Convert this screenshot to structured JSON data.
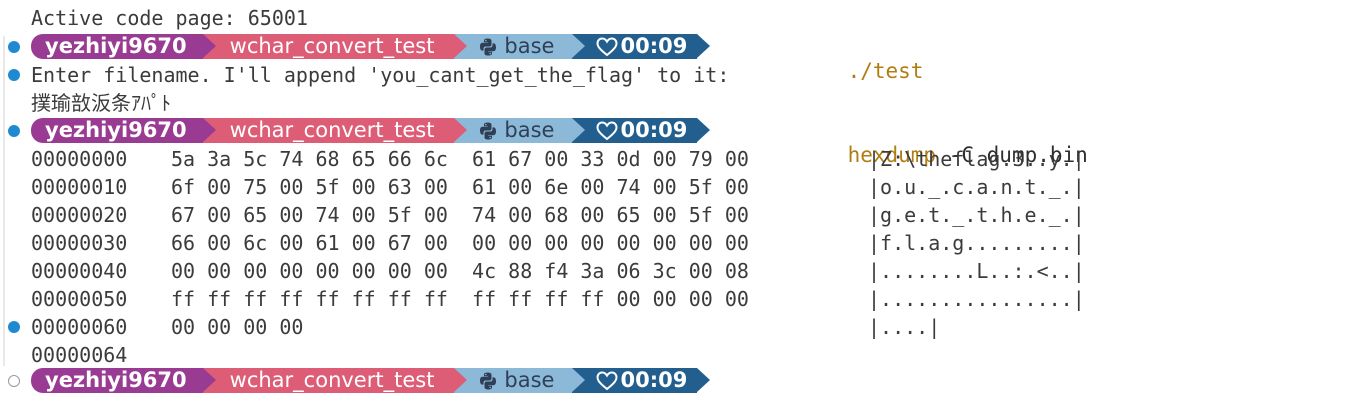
{
  "header_line": "Active code page: 65001",
  "prompt": {
    "user": "yezhiyi9670",
    "directory": "wchar_convert_test",
    "env_icon": "python-icon",
    "env": "base",
    "time_icon": "heart-icon",
    "time": "00:09"
  },
  "commands": {
    "first": "./test",
    "second_name": "hexdump",
    "second_args": " -C dump.bin"
  },
  "program_output": {
    "message": "Enter filename. I'll append 'you_cant_get_the_flag' to it:",
    "garbled": "撲瑜敨汳条ｱﾊﾟﾄ"
  },
  "hexdump_rows": [
    {
      "offset": "00000000",
      "bytes": "5a 3a 5c 74 68 65 66 6c  61 67 00 33 0d 00 79 00",
      "ascii": "|Z:\\theflag.3..y.|"
    },
    {
      "offset": "00000010",
      "bytes": "6f 00 75 00 5f 00 63 00  61 00 6e 00 74 00 5f 00",
      "ascii": "|o.u._.c.a.n.t._.|"
    },
    {
      "offset": "00000020",
      "bytes": "67 00 65 00 74 00 5f 00  74 00 68 00 65 00 5f 00",
      "ascii": "|g.e.t._.t.h.e._.|"
    },
    {
      "offset": "00000030",
      "bytes": "66 00 6c 00 61 00 67 00  00 00 00 00 00 00 00 00",
      "ascii": "|f.l.a.g.........|"
    },
    {
      "offset": "00000040",
      "bytes": "00 00 00 00 00 00 00 00  4c 88 f4 3a 06 3c 00 08",
      "ascii": "|........L..:.<..|"
    },
    {
      "offset": "00000050",
      "bytes": "ff ff ff ff ff ff ff ff  ff ff ff ff 00 00 00 00",
      "ascii": "|................|"
    },
    {
      "offset": "00000060",
      "bytes": "00 00 00 00",
      "ascii": "|....|"
    }
  ],
  "hexdump_end": "00000064",
  "colors": {
    "user_bg": "#9a3b93",
    "dir_bg": "#dd5d77",
    "env_bg": "#8db9d9",
    "time_bg": "#225f8f",
    "command": "#b07d12",
    "marker": "#1f8ad2"
  }
}
